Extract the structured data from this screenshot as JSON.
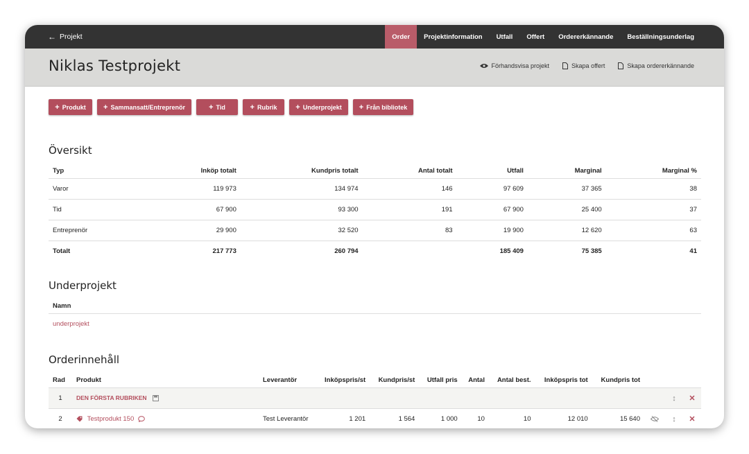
{
  "topbar": {
    "back_label": "Projekt",
    "nav": [
      {
        "label": "Order",
        "active": true
      },
      {
        "label": "Projektinformation"
      },
      {
        "label": "Utfall"
      },
      {
        "label": "Offert"
      },
      {
        "label": "Ordererkännande"
      },
      {
        "label": "Beställningsunderlag"
      }
    ]
  },
  "header": {
    "title": "Niklas Testprojekt",
    "actions": [
      "Förhandsvisa projekt",
      "Skapa offert",
      "Skapa ordererkännande"
    ]
  },
  "add_buttons": [
    "Produkt",
    "Sammansatt/Entreprenör",
    "Tid",
    "Rubrik",
    "Underprojekt",
    "Från bibliotek"
  ],
  "overview": {
    "title": "Översikt",
    "columns": [
      "Typ",
      "Inköp totalt",
      "Kundpris totalt",
      "Antal totalt",
      "Utfall",
      "Marginal",
      "Marginal %"
    ],
    "rows": [
      [
        "Varor",
        "119 973",
        "134 974",
        "146",
        "97 609",
        "37 365",
        "38"
      ],
      [
        "Tid",
        "67 900",
        "93 300",
        "191",
        "67 900",
        "25 400",
        "37"
      ],
      [
        "Entreprenör",
        "29 900",
        "32 520",
        "83",
        "19 900",
        "12 620",
        "63"
      ]
    ],
    "total": [
      "Totalt",
      "217 773",
      "260 794",
      "",
      "185 409",
      "75 385",
      "41"
    ]
  },
  "subprojects": {
    "title": "Underprojekt",
    "column": "Namn",
    "items": [
      "underprojekt"
    ]
  },
  "order": {
    "title": "Orderinnehåll",
    "columns": [
      "Rad",
      "Produkt",
      "Leverantör",
      "Inköpspris/st",
      "Kundpris/st",
      "Utfall pris",
      "Antal",
      "Antal best.",
      "Inköpspris tot",
      "Kundpris tot"
    ],
    "rubrik_row": {
      "rad": "1",
      "label": "DEN FÖRSTA RUBRIKEN"
    },
    "product_row": {
      "rad": "2",
      "product": "Testprodukt 150",
      "supplier": "Test Leverantör",
      "unit_cost": "1 201",
      "unit_price": "1 564",
      "outcome_price": "1 000",
      "qty": "10",
      "qty_ordered": "10",
      "total_cost": "12 010",
      "total_price": "15 640"
    }
  },
  "colors": {
    "accent": "#b34e5d",
    "topbar": "#333333",
    "header": "#dadad8"
  },
  "icons": [
    "arrow-left-icon",
    "eye-icon",
    "document-icon",
    "save-icon",
    "tag-icon",
    "comment-icon",
    "eye-slash-icon",
    "sort-icon",
    "delete-icon"
  ]
}
